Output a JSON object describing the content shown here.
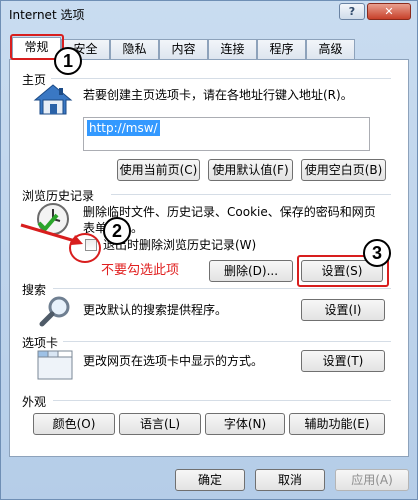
{
  "window": {
    "title": "Internet 选项",
    "help_label": "?",
    "close_label": "✕"
  },
  "tabs": [
    {
      "label": "常规",
      "active": true
    },
    {
      "label": "安全"
    },
    {
      "label": "隐私"
    },
    {
      "label": "内容"
    },
    {
      "label": "连接"
    },
    {
      "label": "程序"
    },
    {
      "label": "高级"
    }
  ],
  "homepage": {
    "section_label": "主页",
    "description": "若要创建主页选项卡，请在各地址行键入地址(R)。",
    "url": "http://msw/",
    "use_current_label": "使用当前页(C)",
    "use_default_label": "使用默认值(F)",
    "use_blank_label": "使用空白页(B)"
  },
  "history": {
    "section_label": "浏览历史记录",
    "description_line1": "删除临时文件、历史记录、Cookie、保存的密码和网页",
    "description_line2": "表单信息。",
    "checkbox_label": "退出时删除浏览历史记录(W)",
    "delete_label": "删除(D)...",
    "settings_label": "设置(S)"
  },
  "search": {
    "section_label": "搜索",
    "description": "更改默认的搜索提供程序。",
    "settings_label": "设置(I)"
  },
  "tabs_section": {
    "section_label": "选项卡",
    "description": "更改网页在选项卡中显示的方式。",
    "settings_label": "设置(T)"
  },
  "appearance": {
    "section_label": "外观",
    "colors_label": "颜色(O)",
    "languages_label": "语言(L)",
    "fonts_label": "字体(N)",
    "accessibility_label": "辅助功能(E)"
  },
  "footer": {
    "ok_label": "确定",
    "cancel_label": "取消",
    "apply_label": "应用(A)"
  },
  "annotations": {
    "step1": "1",
    "step2": "2",
    "step3": "3",
    "note": "不要勾选此项",
    "color": "#e02020"
  },
  "icons": [
    "house-icon",
    "clock-check-icon",
    "magnifier-icon",
    "tabs-window-icon"
  ]
}
